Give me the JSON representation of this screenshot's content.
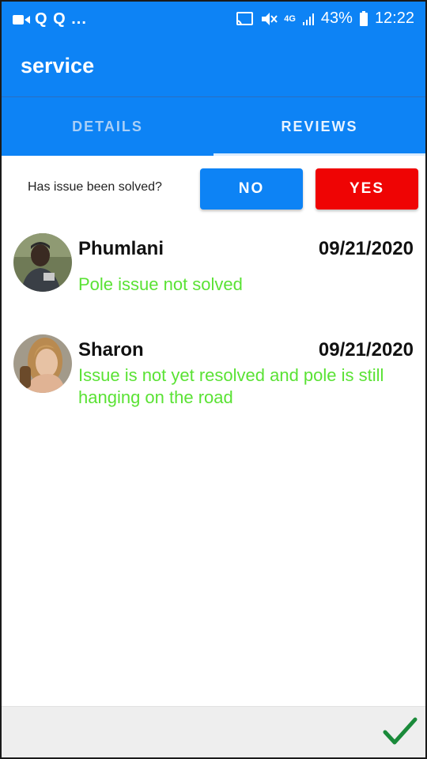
{
  "status_bar": {
    "left_text": "Q Q ...",
    "battery": "43%",
    "time": "12:22",
    "network": "4G"
  },
  "app_bar": {
    "title": "service"
  },
  "tabs": [
    {
      "label": "DETAILS"
    },
    {
      "label": "REVIEWS"
    }
  ],
  "solved": {
    "question": "Has issue been solved?",
    "no_label": "NO",
    "yes_label": "YES"
  },
  "reviews": [
    {
      "name": "Phumlani",
      "date": "09/21/2020",
      "text": "Pole issue not solved"
    },
    {
      "name": "Sharon",
      "date": "09/21/2020",
      "text": "Issue is not yet resolved and pole is still hanging on the road"
    }
  ],
  "colors": {
    "primary": "#0d83f5",
    "yes_red": "#ef0404",
    "review_text_green": "#5ae234",
    "check_green": "#1a8a3a"
  },
  "icons": [
    "video-icon",
    "cast-icon",
    "mute-icon",
    "signal-icon",
    "battery-icon",
    "check-icon"
  ]
}
